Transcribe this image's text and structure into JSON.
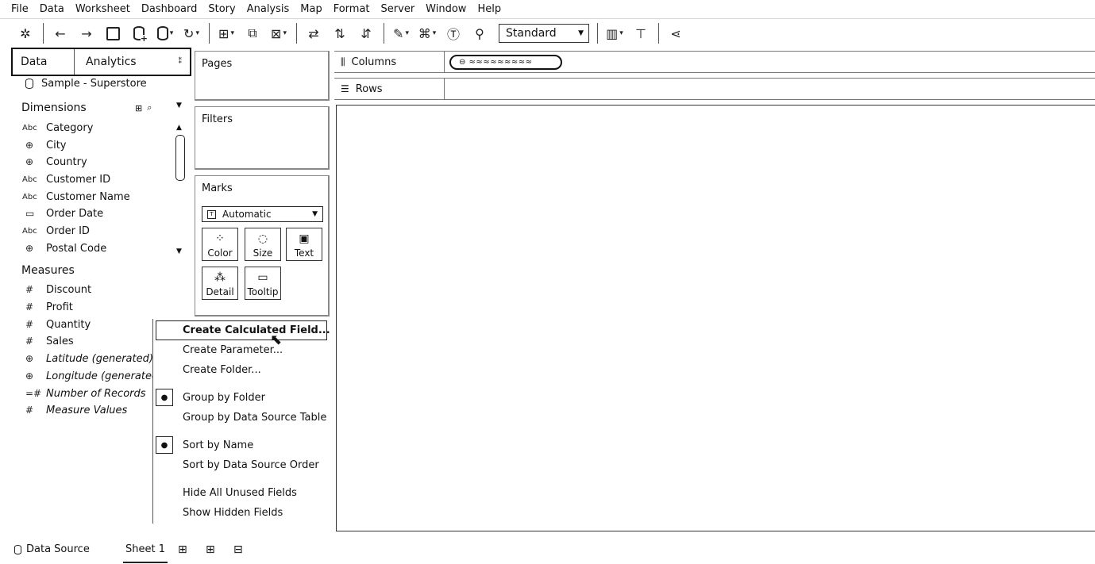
{
  "menu": [
    "File",
    "Data",
    "Worksheet",
    "Dashboard",
    "Story",
    "Analysis",
    "Map",
    "Format",
    "Server",
    "Window",
    "Help"
  ],
  "toolbar": {
    "fit_select": "Standard"
  },
  "data_pane": {
    "tab_data": "Data",
    "tab_analytics": "Analytics",
    "datasource": "Sample - Superstore",
    "dimensions_title": "Dimensions",
    "dimensions": [
      {
        "icon": "Abc",
        "label": "Category"
      },
      {
        "icon": "geo",
        "label": "City"
      },
      {
        "icon": "geo",
        "label": "Country"
      },
      {
        "icon": "Abc",
        "label": "Customer ID"
      },
      {
        "icon": "Abc",
        "label": "Customer Name"
      },
      {
        "icon": "date",
        "label": "Order Date"
      },
      {
        "icon": "Abc",
        "label": "Order ID"
      },
      {
        "icon": "geo",
        "label": "Postal Code"
      }
    ],
    "measures_title": "Measures",
    "measures": [
      {
        "icon": "#",
        "label": "Discount"
      },
      {
        "icon": "#",
        "label": "Profit"
      },
      {
        "icon": "#",
        "label": "Quantity"
      },
      {
        "icon": "#",
        "label": "Sales"
      },
      {
        "icon": "geo",
        "label": "Latitude (generated)"
      },
      {
        "icon": "geo",
        "label": "Longitude (generated"
      },
      {
        "icon": "=#",
        "label": "Number of Records"
      },
      {
        "icon": "#",
        "label": "Measure Values"
      }
    ]
  },
  "cards": {
    "pages": "Pages",
    "filters": "Filters",
    "marks": "Marks",
    "mark_type": "Automatic",
    "mark_buttons": [
      "Color",
      "Size",
      "Text",
      "Detail",
      "Tooltip"
    ]
  },
  "shelves": {
    "columns": "Columns",
    "rows": "Rows"
  },
  "context_menu": {
    "items": [
      "Create Calculated Field...",
      "Create Parameter...",
      "Create Folder...",
      "Group by Folder",
      "Group by Data Source Table",
      "Sort by Name",
      "Sort by Data Source Order",
      "Hide All Unused Fields",
      "Show Hidden Fields"
    ]
  },
  "bottom_tabs": {
    "datasource": "Data Source",
    "sheet": "Sheet 1"
  }
}
